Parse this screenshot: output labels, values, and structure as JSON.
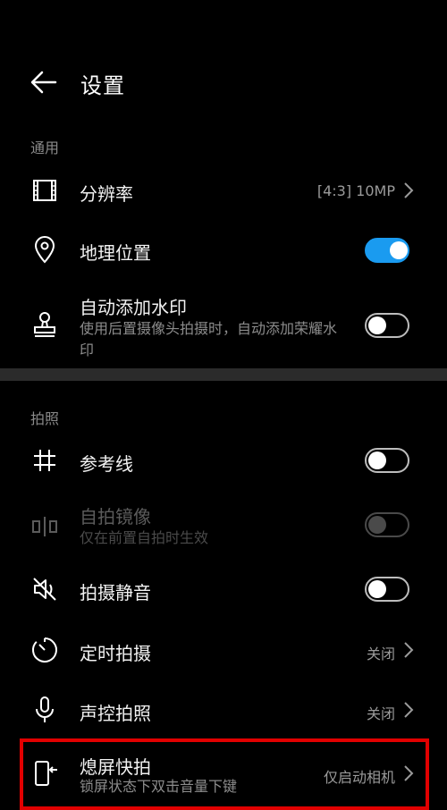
{
  "header": {
    "title": "设置"
  },
  "sections": {
    "general": "通用",
    "photo": "拍照"
  },
  "rows": {
    "resolution": {
      "title": "分辨率",
      "value": "[4:3] 10MP"
    },
    "location": {
      "title": "地理位置",
      "toggle": true
    },
    "watermark": {
      "title": "自动添加水印",
      "subtitle": "使用后置摄像头拍摄时，自动添加荣耀水印",
      "toggle": false
    },
    "gridline": {
      "title": "参考线",
      "toggle": false
    },
    "mirror": {
      "title": "自拍镜像",
      "subtitle": "仅在前置自拍时生效",
      "toggle": false,
      "disabled": true
    },
    "mute": {
      "title": "拍摄静音",
      "toggle": false
    },
    "timer": {
      "title": "定时拍摄",
      "value": "关闭"
    },
    "voice": {
      "title": "声控拍照",
      "value": "关闭"
    },
    "snapshot": {
      "title": "熄屏快拍",
      "subtitle": "锁屏状态下双击音量下键",
      "value": "仅启动相机"
    }
  },
  "colors": {
    "accent": "#1a9bf0",
    "highlight": "#e10000",
    "background": "#000000"
  },
  "icons": [
    "back-arrow-icon",
    "film-icon",
    "location-pin-icon",
    "stamp-icon",
    "grid-icon",
    "mirror-icon",
    "mute-icon",
    "timer-icon",
    "microphone-icon",
    "snapshot-icon",
    "chevron-right-icon"
  ]
}
